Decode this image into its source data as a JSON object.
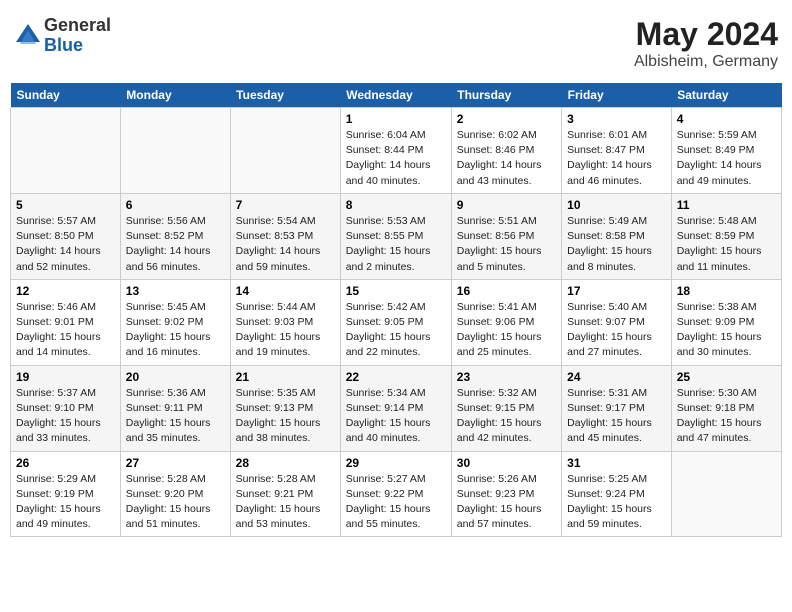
{
  "header": {
    "logo_general": "General",
    "logo_blue": "Blue",
    "month_year": "May 2024",
    "location": "Albisheim, Germany"
  },
  "weekdays": [
    "Sunday",
    "Monday",
    "Tuesday",
    "Wednesday",
    "Thursday",
    "Friday",
    "Saturday"
  ],
  "weeks": [
    [
      {
        "day": "",
        "info": ""
      },
      {
        "day": "",
        "info": ""
      },
      {
        "day": "",
        "info": ""
      },
      {
        "day": "1",
        "info": "Sunrise: 6:04 AM\nSunset: 8:44 PM\nDaylight: 14 hours\nand 40 minutes."
      },
      {
        "day": "2",
        "info": "Sunrise: 6:02 AM\nSunset: 8:46 PM\nDaylight: 14 hours\nand 43 minutes."
      },
      {
        "day": "3",
        "info": "Sunrise: 6:01 AM\nSunset: 8:47 PM\nDaylight: 14 hours\nand 46 minutes."
      },
      {
        "day": "4",
        "info": "Sunrise: 5:59 AM\nSunset: 8:49 PM\nDaylight: 14 hours\nand 49 minutes."
      }
    ],
    [
      {
        "day": "5",
        "info": "Sunrise: 5:57 AM\nSunset: 8:50 PM\nDaylight: 14 hours\nand 52 minutes."
      },
      {
        "day": "6",
        "info": "Sunrise: 5:56 AM\nSunset: 8:52 PM\nDaylight: 14 hours\nand 56 minutes."
      },
      {
        "day": "7",
        "info": "Sunrise: 5:54 AM\nSunset: 8:53 PM\nDaylight: 14 hours\nand 59 minutes."
      },
      {
        "day": "8",
        "info": "Sunrise: 5:53 AM\nSunset: 8:55 PM\nDaylight: 15 hours\nand 2 minutes."
      },
      {
        "day": "9",
        "info": "Sunrise: 5:51 AM\nSunset: 8:56 PM\nDaylight: 15 hours\nand 5 minutes."
      },
      {
        "day": "10",
        "info": "Sunrise: 5:49 AM\nSunset: 8:58 PM\nDaylight: 15 hours\nand 8 minutes."
      },
      {
        "day": "11",
        "info": "Sunrise: 5:48 AM\nSunset: 8:59 PM\nDaylight: 15 hours\nand 11 minutes."
      }
    ],
    [
      {
        "day": "12",
        "info": "Sunrise: 5:46 AM\nSunset: 9:01 PM\nDaylight: 15 hours\nand 14 minutes."
      },
      {
        "day": "13",
        "info": "Sunrise: 5:45 AM\nSunset: 9:02 PM\nDaylight: 15 hours\nand 16 minutes."
      },
      {
        "day": "14",
        "info": "Sunrise: 5:44 AM\nSunset: 9:03 PM\nDaylight: 15 hours\nand 19 minutes."
      },
      {
        "day": "15",
        "info": "Sunrise: 5:42 AM\nSunset: 9:05 PM\nDaylight: 15 hours\nand 22 minutes."
      },
      {
        "day": "16",
        "info": "Sunrise: 5:41 AM\nSunset: 9:06 PM\nDaylight: 15 hours\nand 25 minutes."
      },
      {
        "day": "17",
        "info": "Sunrise: 5:40 AM\nSunset: 9:07 PM\nDaylight: 15 hours\nand 27 minutes."
      },
      {
        "day": "18",
        "info": "Sunrise: 5:38 AM\nSunset: 9:09 PM\nDaylight: 15 hours\nand 30 minutes."
      }
    ],
    [
      {
        "day": "19",
        "info": "Sunrise: 5:37 AM\nSunset: 9:10 PM\nDaylight: 15 hours\nand 33 minutes."
      },
      {
        "day": "20",
        "info": "Sunrise: 5:36 AM\nSunset: 9:11 PM\nDaylight: 15 hours\nand 35 minutes."
      },
      {
        "day": "21",
        "info": "Sunrise: 5:35 AM\nSunset: 9:13 PM\nDaylight: 15 hours\nand 38 minutes."
      },
      {
        "day": "22",
        "info": "Sunrise: 5:34 AM\nSunset: 9:14 PM\nDaylight: 15 hours\nand 40 minutes."
      },
      {
        "day": "23",
        "info": "Sunrise: 5:32 AM\nSunset: 9:15 PM\nDaylight: 15 hours\nand 42 minutes."
      },
      {
        "day": "24",
        "info": "Sunrise: 5:31 AM\nSunset: 9:17 PM\nDaylight: 15 hours\nand 45 minutes."
      },
      {
        "day": "25",
        "info": "Sunrise: 5:30 AM\nSunset: 9:18 PM\nDaylight: 15 hours\nand 47 minutes."
      }
    ],
    [
      {
        "day": "26",
        "info": "Sunrise: 5:29 AM\nSunset: 9:19 PM\nDaylight: 15 hours\nand 49 minutes."
      },
      {
        "day": "27",
        "info": "Sunrise: 5:28 AM\nSunset: 9:20 PM\nDaylight: 15 hours\nand 51 minutes."
      },
      {
        "day": "28",
        "info": "Sunrise: 5:28 AM\nSunset: 9:21 PM\nDaylight: 15 hours\nand 53 minutes."
      },
      {
        "day": "29",
        "info": "Sunrise: 5:27 AM\nSunset: 9:22 PM\nDaylight: 15 hours\nand 55 minutes."
      },
      {
        "day": "30",
        "info": "Sunrise: 5:26 AM\nSunset: 9:23 PM\nDaylight: 15 hours\nand 57 minutes."
      },
      {
        "day": "31",
        "info": "Sunrise: 5:25 AM\nSunset: 9:24 PM\nDaylight: 15 hours\nand 59 minutes."
      },
      {
        "day": "",
        "info": ""
      }
    ]
  ]
}
